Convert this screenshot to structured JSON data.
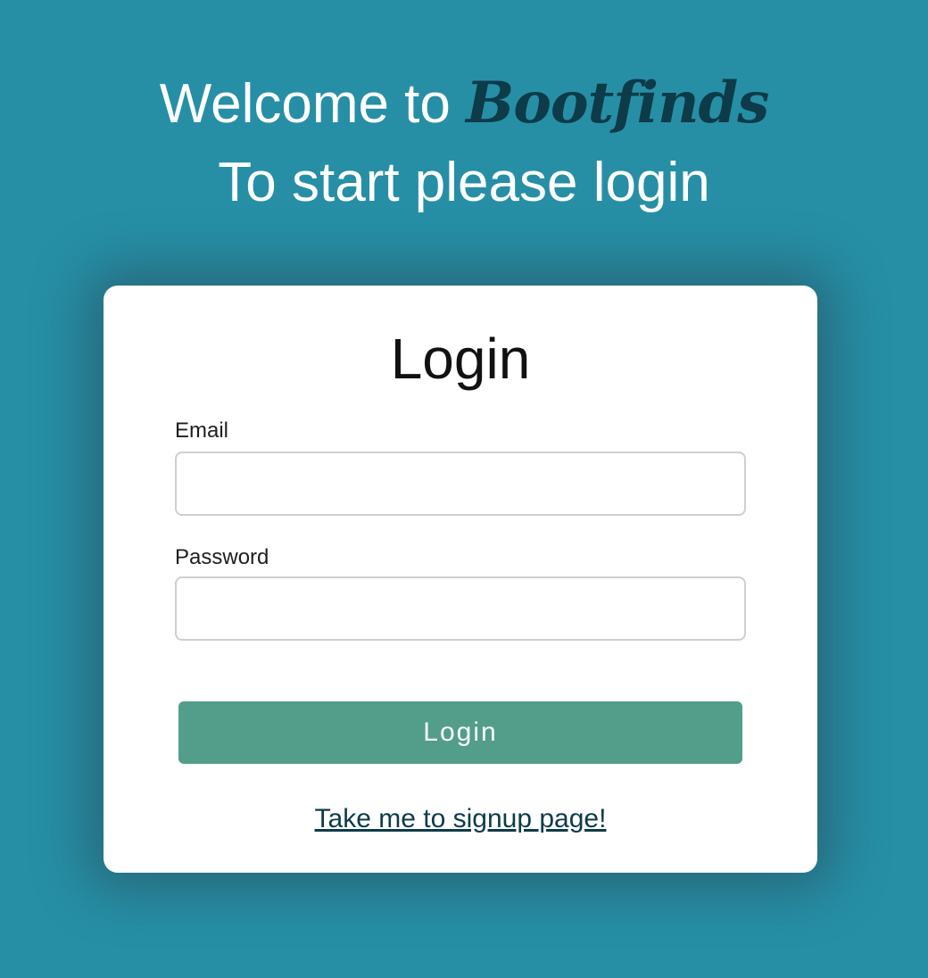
{
  "hero": {
    "welcome_prefix": "Welcome to ",
    "brand_name": "Bootfinds",
    "subtitle": "To start please login"
  },
  "login_card": {
    "title": "Login",
    "email_label": "Email",
    "email_value": "",
    "email_placeholder": "",
    "password_label": "Password",
    "password_value": "",
    "password_placeholder": "",
    "submit_label": "Login",
    "signup_link_text": "Take me to signup page!"
  },
  "colors": {
    "background": "#268fa6",
    "brand_text": "#0d3b4a",
    "card": "#ffffff",
    "button": "#529e8b",
    "link": "#0d3b4a"
  }
}
